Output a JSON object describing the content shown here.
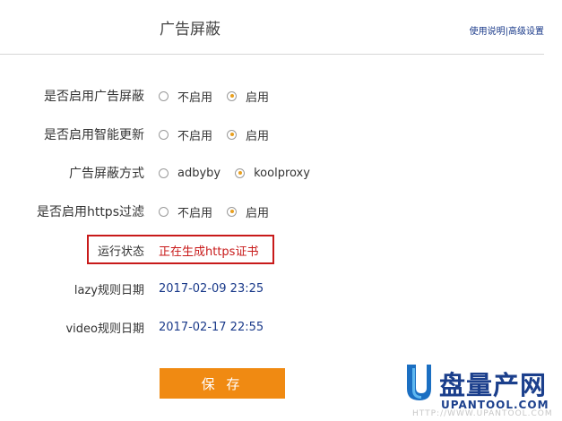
{
  "header": {
    "title": "广告屏蔽",
    "help_link": "使用说明",
    "separator": "|",
    "advanced_link": "高级设置"
  },
  "form": {
    "enable_adblock": {
      "label": "是否启用广告屏蔽",
      "options": [
        "不启用",
        "启用"
      ],
      "selected": "启用"
    },
    "enable_smart_update": {
      "label": "是否启用智能更新",
      "options": [
        "不启用",
        "启用"
      ],
      "selected": "启用"
    },
    "adblock_method": {
      "label": "广告屏蔽方式",
      "options": [
        "adbyby",
        "koolproxy"
      ],
      "selected": "koolproxy"
    },
    "enable_https_filter": {
      "label": "是否启用https过滤",
      "options": [
        "不启用",
        "启用"
      ],
      "selected": "启用"
    },
    "run_status": {
      "label": "运行状态",
      "value": "正在生成https证书",
      "color": "#c81a1a"
    },
    "lazy_rule_date": {
      "label": "lazy规则日期",
      "value": "2017-02-09 23:25"
    },
    "video_rule_date": {
      "label": "video规则日期",
      "value": "2017-02-17 22:55"
    },
    "save_label": "保 存"
  },
  "watermark": {
    "brand": "盘量产网",
    "site": "UPANTOOL.COM",
    "faint": "HTTP://WWW.UPANTOOL.COM"
  },
  "colors": {
    "accent": "#f08a12",
    "radio_dot": "#e8a020",
    "link": "#1a3a8a",
    "status_red": "#c81a1a"
  }
}
